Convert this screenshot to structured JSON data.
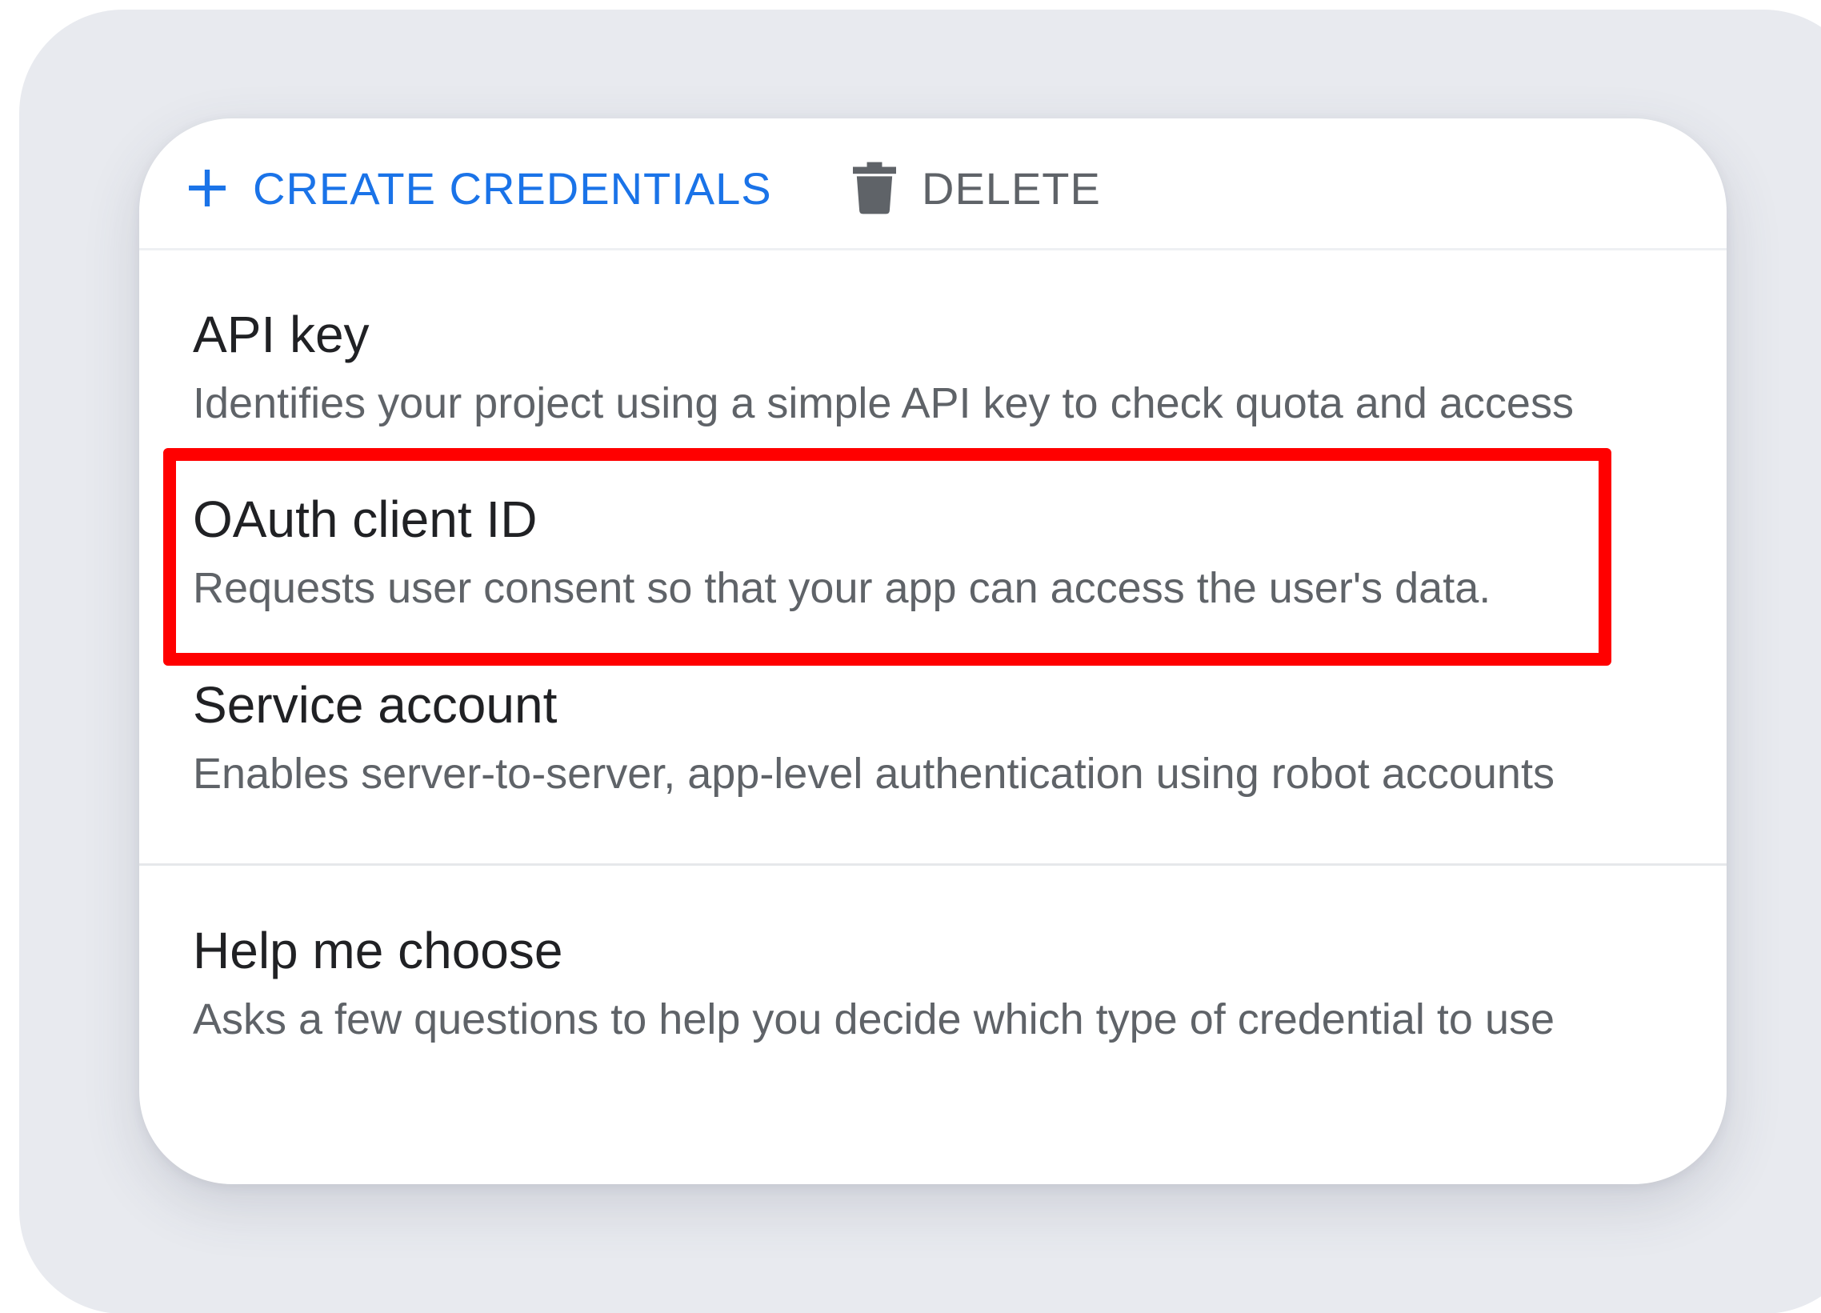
{
  "toolbar": {
    "create_label": "CREATE CREDENTIALS",
    "delete_label": "DELETE",
    "create_icon": "plus-icon",
    "delete_icon": "trash-icon",
    "create_color": "#1a73e8",
    "delete_color": "#5f6368"
  },
  "menu": {
    "items": [
      {
        "title": "API key",
        "description": "Identifies your project using a simple API key to check quota and access"
      },
      {
        "title": "OAuth client ID",
        "description": "Requests user consent so that your app can access the user's data.",
        "highlighted": true
      },
      {
        "title": "Service account",
        "description": "Enables server-to-server, app-level authentication using robot accounts"
      }
    ],
    "help": {
      "title": "Help me choose",
      "description": "Asks a few questions to help you decide which type of credential to use"
    }
  },
  "colors": {
    "highlight": "#ff0000",
    "backdrop": "#e8eaef",
    "card": "#ffffff"
  }
}
